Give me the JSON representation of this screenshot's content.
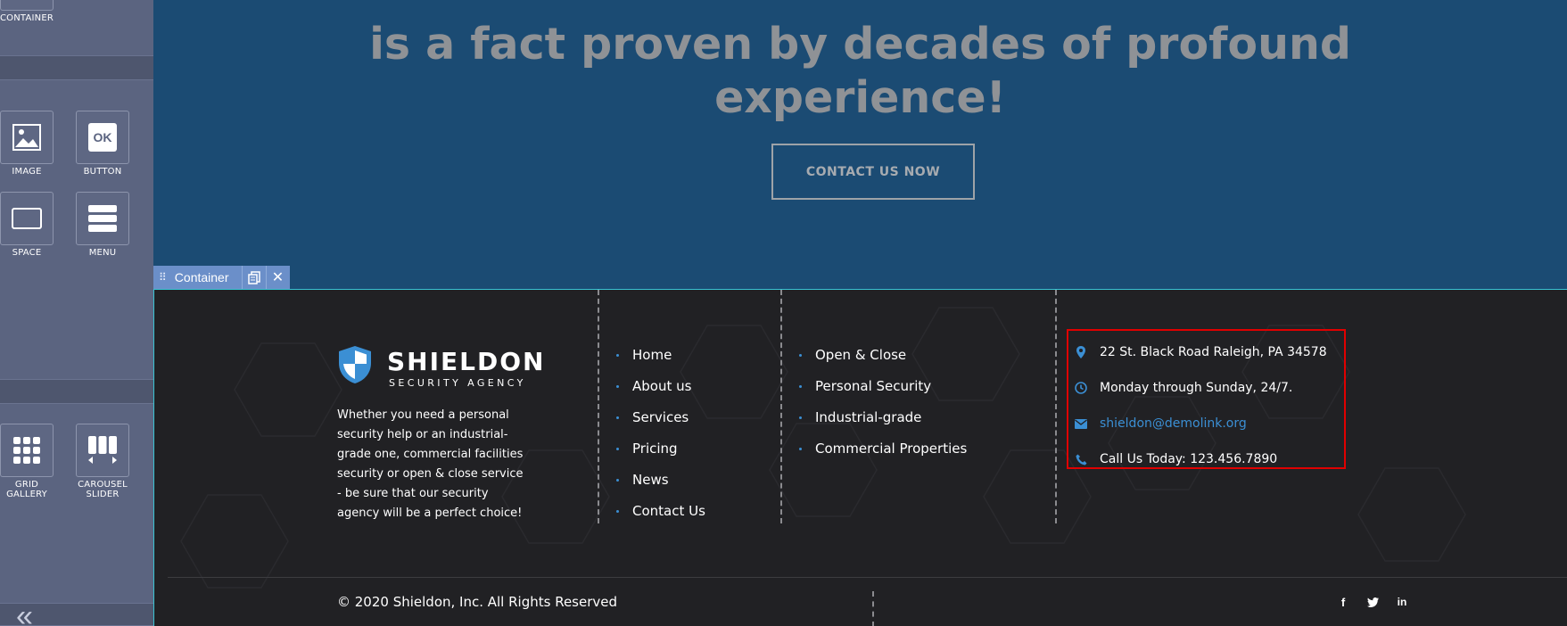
{
  "builder_panel": {
    "tools": [
      {
        "label": "CONTAINER",
        "icon": "container-icon"
      },
      {
        "label": "IMAGE",
        "icon": "image-icon"
      },
      {
        "label": "BUTTON",
        "icon": "button-icon",
        "glyph": "OK"
      },
      {
        "label": "SPACE",
        "icon": "space-icon"
      },
      {
        "label": "MENU",
        "icon": "menu-icon"
      },
      {
        "label": "GRID\nGALLERY",
        "icon": "grid-gallery-icon"
      },
      {
        "label": "CAROUSEL\nSLIDER",
        "icon": "carousel-slider-icon"
      }
    ],
    "collapse_glyph": "«"
  },
  "hero": {
    "title_lines": [
      "is a fact proven by decades of profound",
      "experience!"
    ],
    "cta_label": "CONTACT US NOW"
  },
  "container_toolbar": {
    "label": "Container",
    "drag_glyph": "⠿",
    "copy_icon": "copy-icon",
    "close_glyph": "✕"
  },
  "footer": {
    "brand": {
      "name": "SHIELDON",
      "tagline": "SECURITY AGENCY",
      "description": "Whether you need a personal security help or an industrial-grade one, commercial facilities security or open & close service - be sure that our security agency will be a perfect choice!"
    },
    "nav_links": [
      "Home",
      "About us",
      "Services",
      "Pricing",
      "News",
      "Contact Us"
    ],
    "service_links": [
      "Open & Close",
      "Personal Security",
      "Industrial-grade",
      "Commercial Properties"
    ],
    "contact": {
      "address": "22 St. Black Road Raleigh, PA 34578",
      "hours": "Monday through Sunday, 24/7.",
      "email": "shieldon@demolink.org",
      "phone": "Call Us Today: 123.456.7890"
    },
    "copyright": "© 2020 Shieldon, Inc. All Rights Reserved",
    "social": [
      {
        "icon": "facebook-icon",
        "glyph": "f"
      },
      {
        "icon": "twitter-icon",
        "glyph": "t"
      },
      {
        "icon": "linkedin-icon",
        "glyph": "in"
      }
    ]
  },
  "colors": {
    "hero_bg": "#1b4b73",
    "footer_bg": "#212124",
    "accent": "#3b8fd4",
    "selection": "#39c3d2",
    "highlight_box": "#e00000",
    "panel_bg": "#5b6480",
    "toolbar": "#6b8fc9"
  }
}
